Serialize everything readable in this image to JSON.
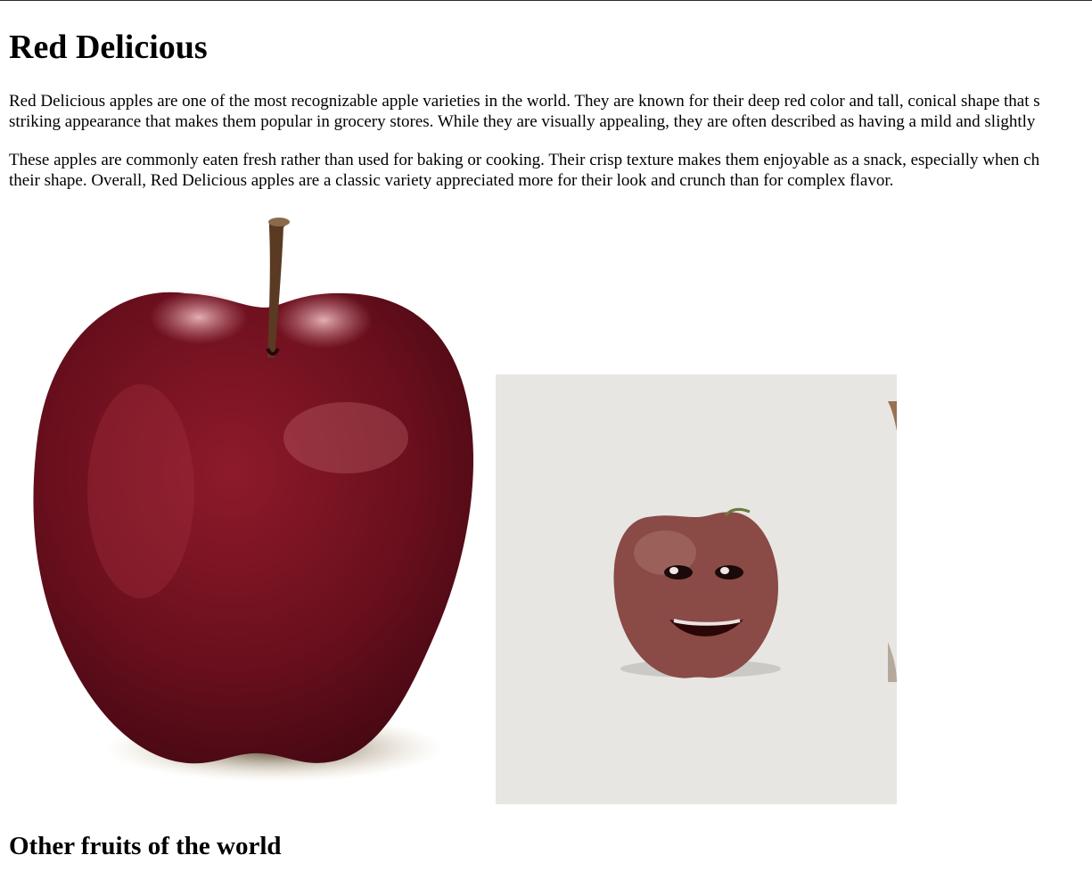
{
  "article": {
    "title": "Red Delicious",
    "paragraph1": {
      "line1": "Red Delicious apples are one of the most recognizable apple varieties in the world. They are known for their deep red color and tall, conical shape that s",
      "line2": "striking appearance that makes them popular in grocery stores. While they are visually appealing, they are often described as having a mild and slightly"
    },
    "paragraph2": {
      "line1": "These apples are commonly eaten fresh rather than used for baking or cooking. Their crisp texture makes them enjoyable as a snack, especially when ch",
      "line2": "their shape. Overall, Red Delicious apples are a classic variety appreciated more for their look and crunch than for complex flavor."
    },
    "images": [
      {
        "name": "red-delicious-apple-photo",
        "icon": "red-apple"
      },
      {
        "name": "talking-apple-photo",
        "icon": "apple-with-face"
      }
    ],
    "section_heading": "Other fruits of the world"
  },
  "colors": {
    "apple_red": "#6e0f1c",
    "apple_dark": "#3d0710",
    "background_gray": "#e7e6e3",
    "talking_apple": "#8a4a45"
  }
}
